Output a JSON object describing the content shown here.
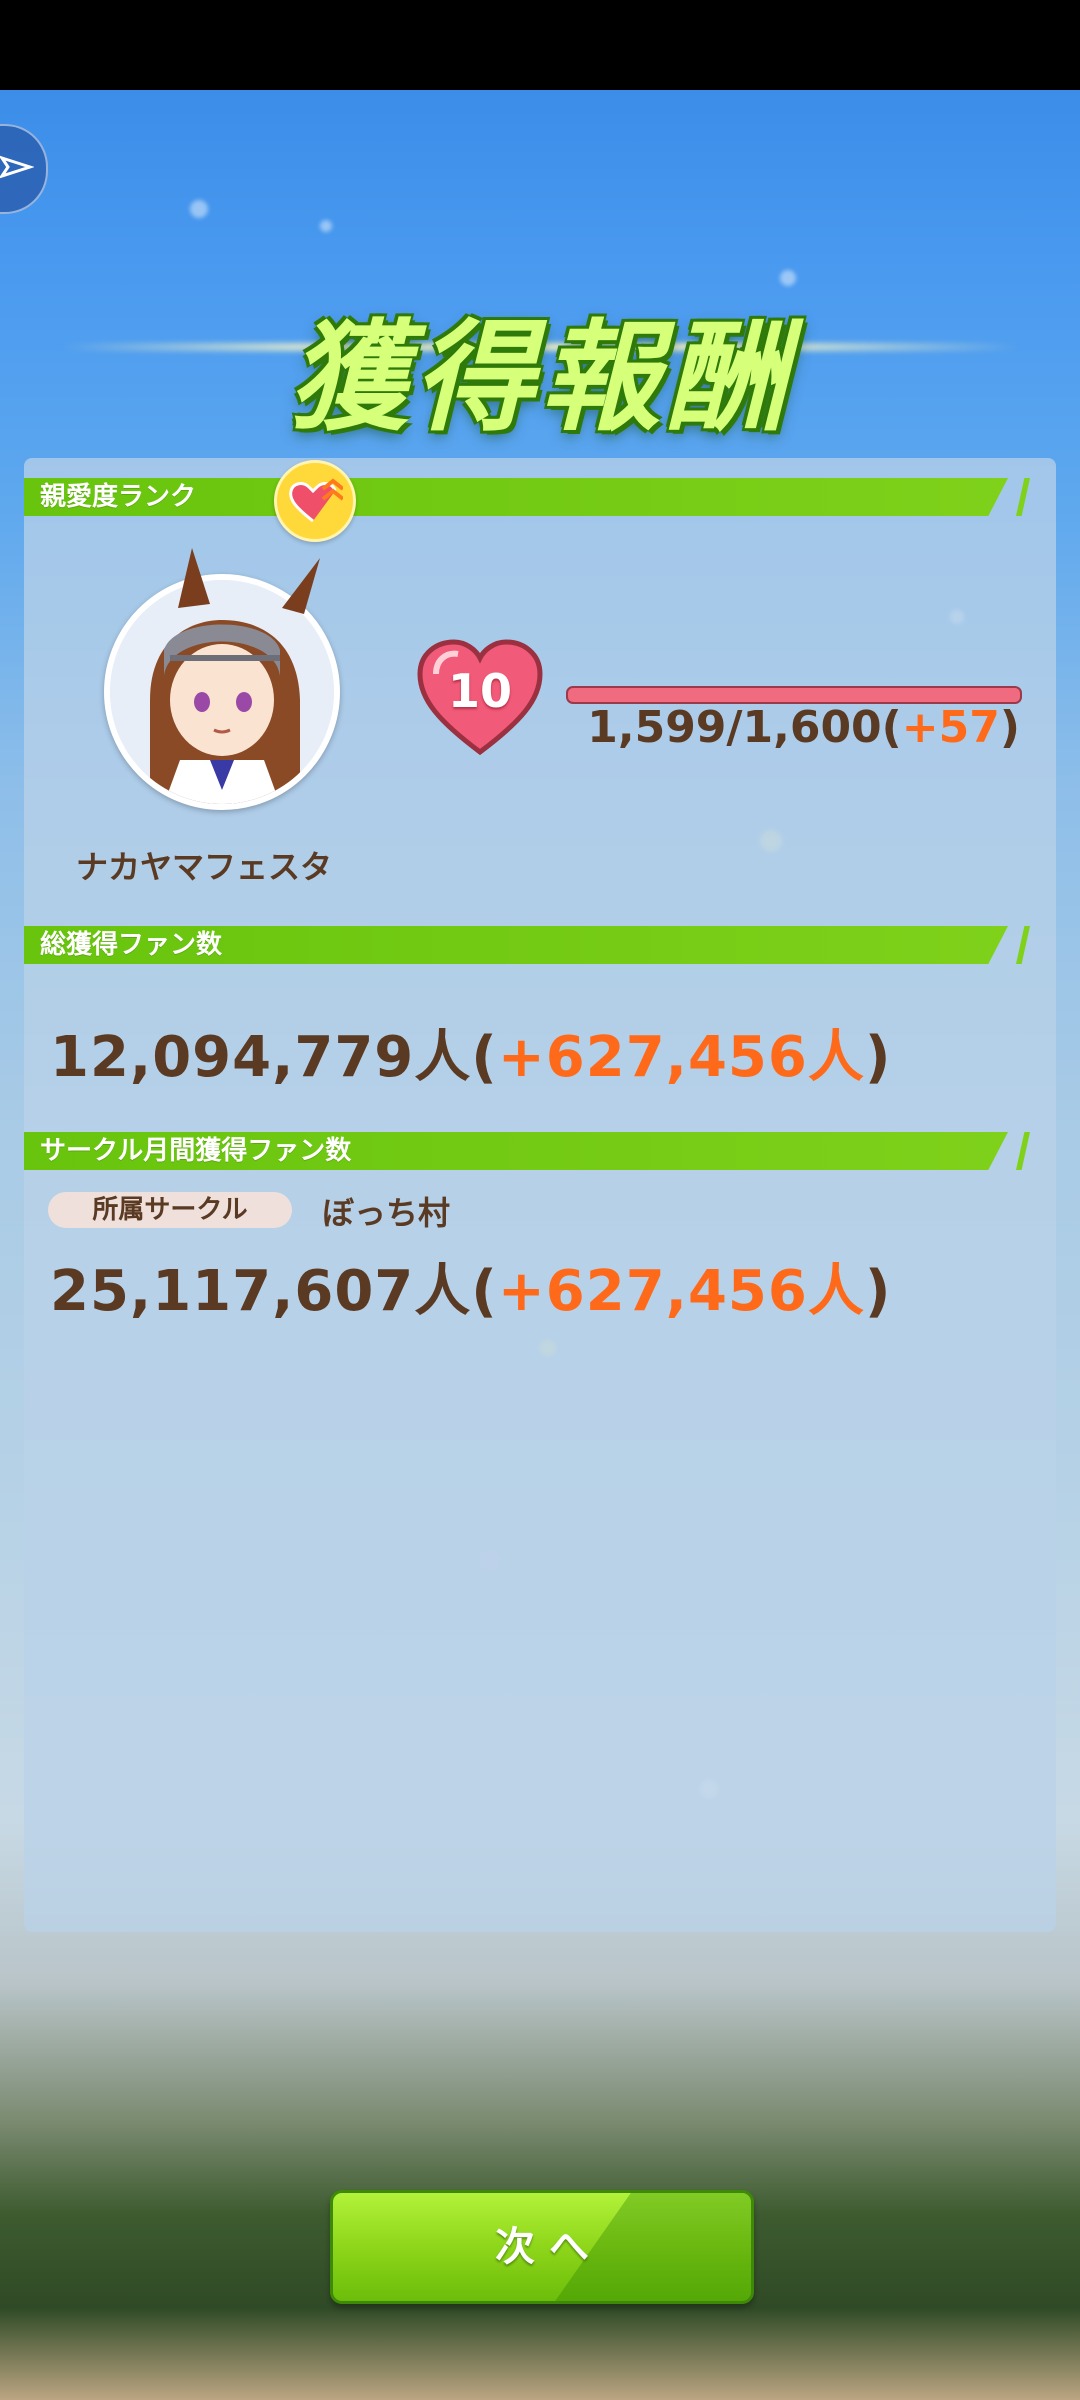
{
  "title": "獲得報酬",
  "sections": {
    "affection": {
      "label": "親愛度ランク",
      "character_name": "ナカヤマフェスタ",
      "rank_level": "10",
      "progress": {
        "current": 1599,
        "max": 1600,
        "gain": 57
      },
      "progress_text": "1,599/1,600(",
      "progress_gain_text": "+57",
      "progress_close": ")"
    },
    "fans": {
      "label": "総獲得ファン数",
      "total": "12,094,779人(",
      "gain": "+627,456人",
      "close": ")"
    },
    "circle": {
      "label": "サークル月間獲得ファン数",
      "affiliation_label": "所属サークル",
      "circle_name": "ぼっち村",
      "total": "25,117,607人(",
      "gain": "+627,456人",
      "close": ")"
    }
  },
  "next_button": "次 へ",
  "icons": {
    "top_left": "share-icon",
    "rank_badge": "heart-rank-up-icon",
    "level_heart": "heart-icon"
  },
  "colors": {
    "section_bar": "#7fd11a",
    "gain_text": "#ff6a1a",
    "main_text": "#5a3a22",
    "next_button": "#8ed61a"
  }
}
